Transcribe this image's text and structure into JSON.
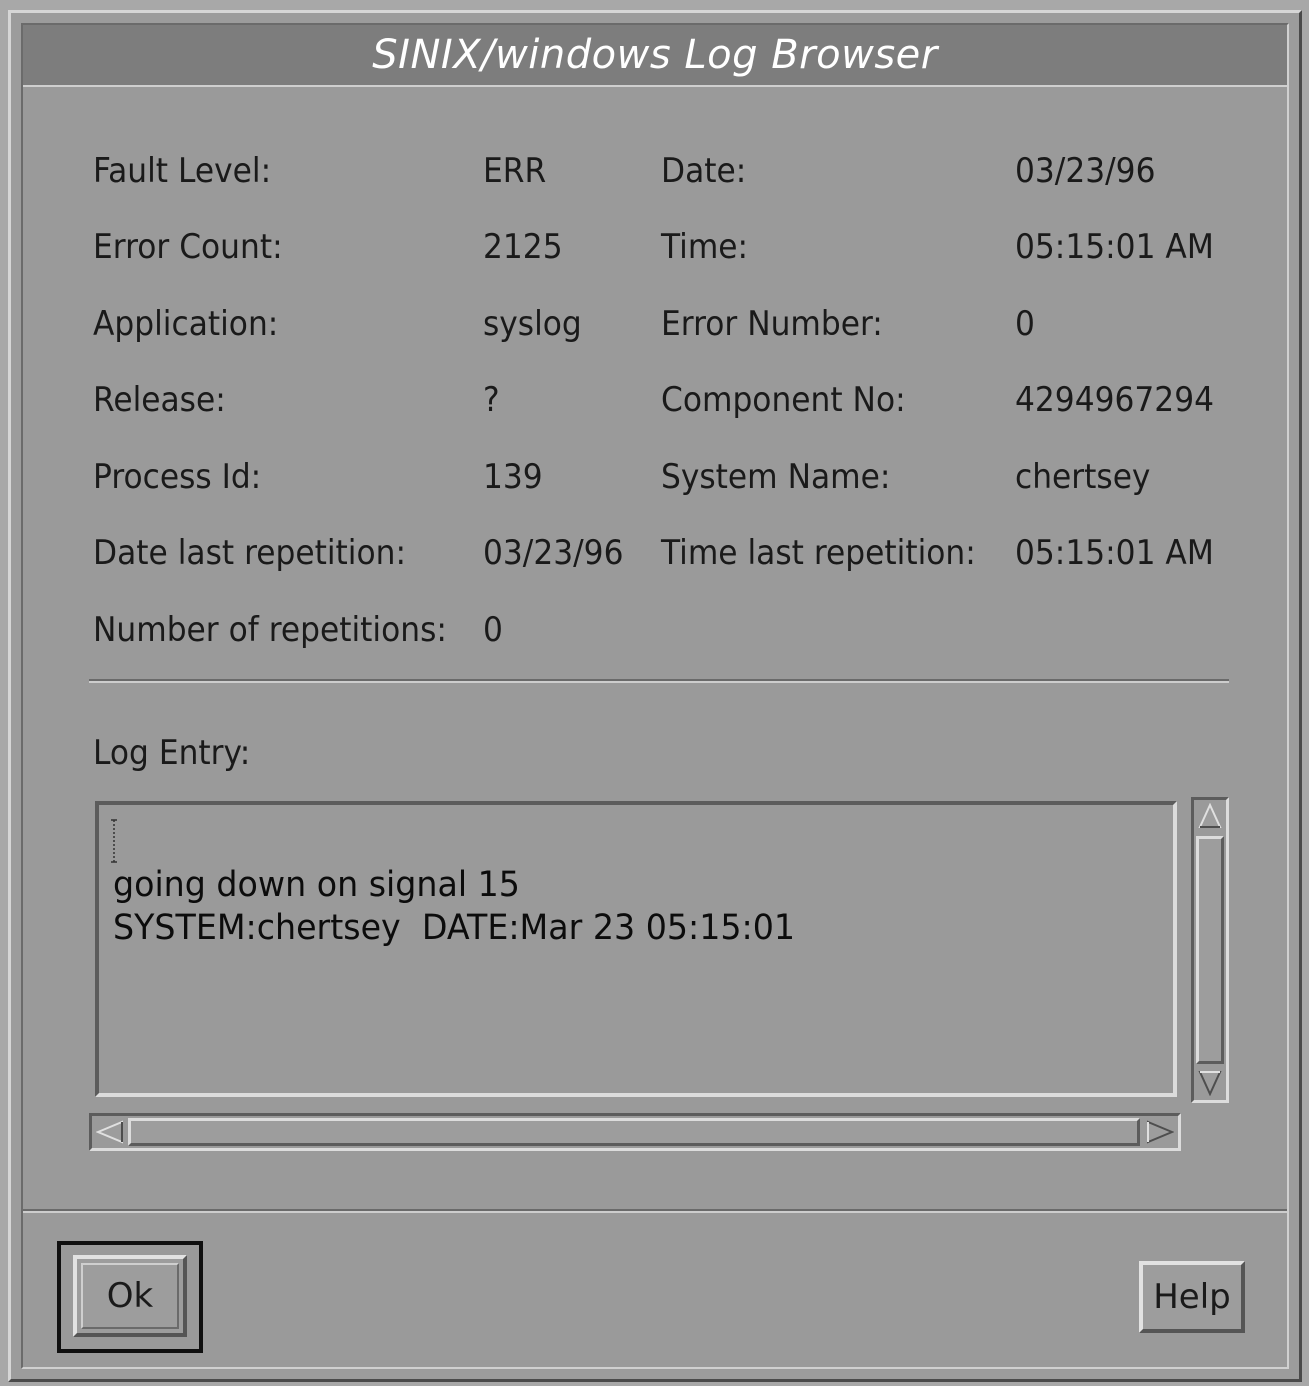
{
  "window": {
    "title": "SINIX/windows Log Browser"
  },
  "fields": {
    "fault_level": {
      "label": "Fault Level:",
      "value": "ERR"
    },
    "error_count": {
      "label": "Error Count:",
      "value": "2125"
    },
    "application": {
      "label": "Application:",
      "value": "syslog"
    },
    "release": {
      "label": "Release:",
      "value": "?"
    },
    "process_id": {
      "label": "Process Id:",
      "value": "139"
    },
    "date_last_repetition": {
      "label": "Date last repetition:",
      "value": "03/23/96"
    },
    "number_of_repetitions": {
      "label": "Number of repetitions:",
      "value": "0"
    },
    "date": {
      "label": "Date:",
      "value": "03/23/96"
    },
    "time": {
      "label": "Time:",
      "value": "05:15:01 AM"
    },
    "error_number": {
      "label": "Error Number:",
      "value": "0"
    },
    "component_no": {
      "label": "Component No:",
      "value": "4294967294"
    },
    "system_name": {
      "label": "System Name:",
      "value": "chertsey"
    },
    "time_last_repetition": {
      "label": "Time last repetition:",
      "value": "05:15:01 AM"
    }
  },
  "log": {
    "label": "Log Entry:",
    "lines": [
      "going down on signal 15",
      "SYSTEM:chertsey  DATE:Mar 23 05:15:01"
    ]
  },
  "icons": {
    "scroll_up": "scroll-up-arrow-icon",
    "scroll_down": "scroll-down-arrow-icon",
    "scroll_left": "scroll-left-arrow-icon",
    "scroll_right": "scroll-right-arrow-icon",
    "text_cursor": "text-cursor-icon"
  },
  "buttons": {
    "ok": "Ok",
    "help": "Help"
  },
  "colors": {
    "title_bar": "#7d7d7d",
    "window_bg": "#9a9a9a",
    "text": "#1a1a1a"
  }
}
